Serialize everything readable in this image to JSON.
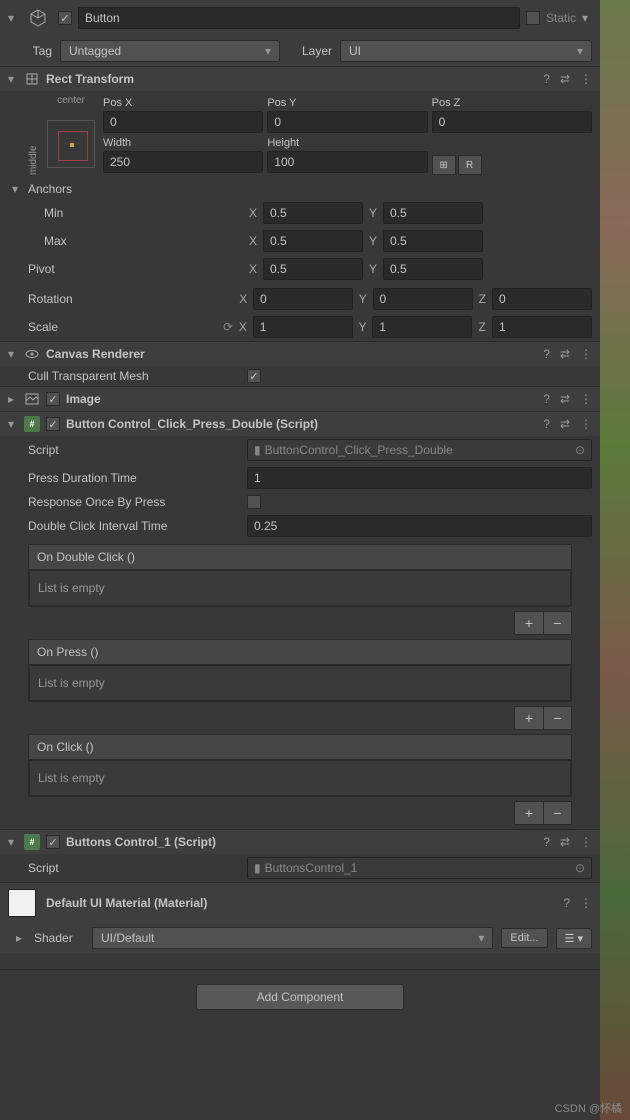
{
  "header": {
    "name": "Button",
    "active": true,
    "static_label": "Static",
    "static": false,
    "tag_label": "Tag",
    "tag_value": "Untagged",
    "layer_label": "Layer",
    "layer_value": "UI"
  },
  "rect_transform": {
    "title": "Rect Transform",
    "anchor_preset_h": "center",
    "anchor_preset_v": "middle",
    "pos_x_label": "Pos X",
    "pos_x": "0",
    "pos_y_label": "Pos Y",
    "pos_y": "0",
    "pos_z_label": "Pos Z",
    "pos_z": "0",
    "width_label": "Width",
    "width": "250",
    "height_label": "Height",
    "height": "100",
    "blueprint_btn": "⊞",
    "raw_btn": "R",
    "anchors_label": "Anchors",
    "min_label": "Min",
    "min_x": "0.5",
    "min_y": "0.5",
    "max_label": "Max",
    "max_x": "0.5",
    "max_y": "0.5",
    "pivot_label": "Pivot",
    "pivot_x": "0.5",
    "pivot_y": "0.5",
    "rotation_label": "Rotation",
    "rot_x": "0",
    "rot_y": "0",
    "rot_z": "0",
    "scale_label": "Scale",
    "scale_x": "1",
    "scale_y": "1",
    "scale_z": "1",
    "x_label": "X",
    "y_label": "Y",
    "z_label": "Z"
  },
  "canvas_renderer": {
    "title": "Canvas Renderer",
    "cull_label": "Cull Transparent Mesh",
    "cull_value": true
  },
  "image": {
    "title": "Image",
    "enabled": true
  },
  "button_script": {
    "title": "Button Control_Click_Press_Double (Script)",
    "enabled": true,
    "script_label": "Script",
    "script_value": "ButtonControl_Click_Press_Double",
    "press_duration_label": "Press Duration Time",
    "press_duration": "1",
    "response_once_label": "Response Once By Press",
    "response_once": false,
    "double_click_interval_label": "Double Click Interval Time",
    "double_click_interval": "0.25",
    "events": [
      {
        "name": "On Double Click ()",
        "empty": "List is empty"
      },
      {
        "name": "On Press ()",
        "empty": "List is empty"
      },
      {
        "name": "On Click ()",
        "empty": "List is empty"
      }
    ]
  },
  "buttons_control": {
    "title": "Buttons Control_1 (Script)",
    "enabled": true,
    "script_label": "Script",
    "script_value": "ButtonsControl_1"
  },
  "material": {
    "title": "Default UI Material (Material)",
    "shader_label": "Shader",
    "shader_value": "UI/Default",
    "edit_btn": "Edit...",
    "menu_btn": "☰ ▾"
  },
  "add_component": "Add Component",
  "watermark": "CSDN @怀橘",
  "icons": {
    "help": "?",
    "preset": "⇄",
    "menu": "⋮",
    "plus": "+",
    "minus": "−"
  }
}
